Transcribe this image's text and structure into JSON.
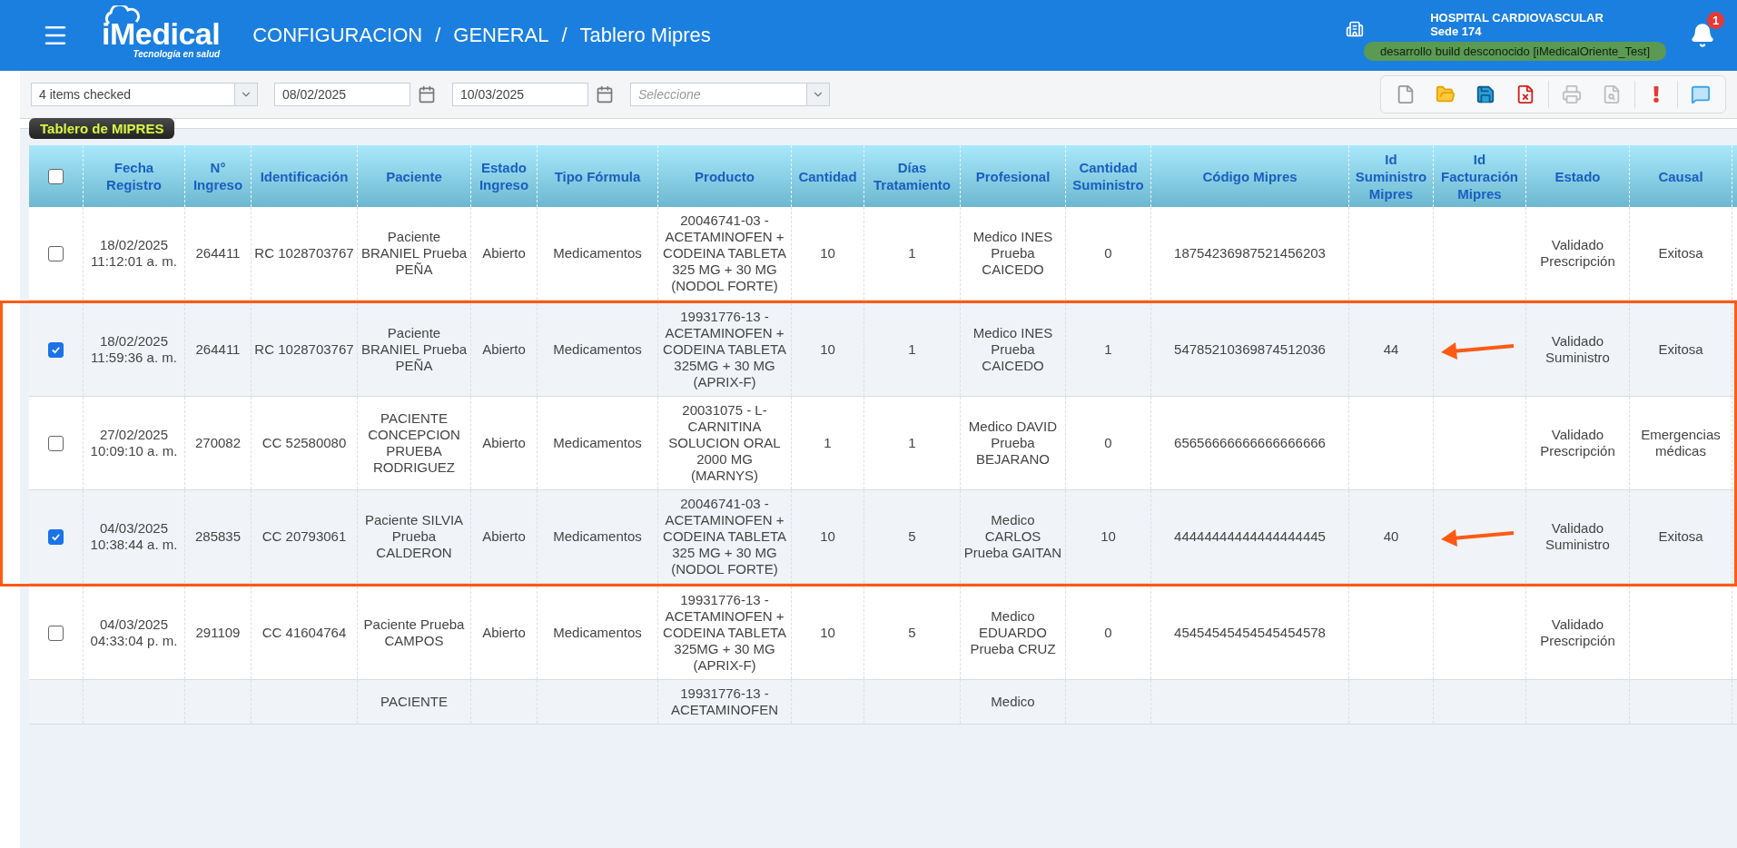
{
  "header": {
    "logo": {
      "name": "iMedical",
      "tagline": "Tecnología en salud"
    },
    "breadcrumb": {
      "separator": "/",
      "items": [
        "CONFIGURACION",
        "GENERAL",
        "Tablero Mipres"
      ]
    },
    "hospital": "HOSPITAL CARDIOVASCULAR",
    "sede": "Sede 174",
    "build": "desarrollo build desconocido [iMedicalOriente_Test]",
    "notifications": "1"
  },
  "filters": [
    {
      "kind": "multiselect",
      "value": "4 items checked"
    },
    {
      "kind": "date",
      "value": "08/02/2025"
    },
    {
      "kind": "date",
      "value": "10/03/2025"
    },
    {
      "kind": "select",
      "placeholder": "Seleccione"
    }
  ],
  "toolbar": [
    {
      "kind": "new",
      "disabled": false
    },
    {
      "kind": "open",
      "disabled": false
    },
    {
      "kind": "save",
      "disabled": false
    },
    {
      "kind": "delete",
      "disabled": false
    },
    {
      "kind": "print",
      "disabled": true
    },
    {
      "kind": "preview",
      "disabled": true
    },
    {
      "kind": "alert",
      "disabled": false
    },
    {
      "kind": "comment",
      "disabled": false
    }
  ],
  "section_title": "Tablero de MIPRES",
  "table": {
    "select_all": {
      "checked": false
    },
    "columns": [
      "Fecha Registro",
      "N° Ingreso",
      "Identificación",
      "Paciente",
      "Estado Ingreso",
      "Tipo Fórmula",
      "Producto",
      "Cantidad",
      "Días Tratamiento",
      "Profesional",
      "Cantidad Suministro",
      "Código Mipres",
      "Id Suministro Mipres",
      "Id Facturación Mipres",
      "Estado",
      "Causal"
    ],
    "rows": [
      {
        "checked": false,
        "annotated": false,
        "arrow": false,
        "cells": [
          "18/02/2025 11:12:01 a. m.",
          "264411",
          "RC 1028703767",
          "Paciente BRANIEL Prueba PEÑA",
          "Abierto",
          "Medicamentos",
          "20046741-03 - ACETAMINOFEN + CODEINA TABLETA 325 MG + 30 MG (NODOL FORTE)",
          "10",
          "1",
          "Medico INES Prueba CAICEDO",
          "0",
          "18754236987521456203",
          null,
          null,
          "Validado Prescripción",
          "Exitosa"
        ]
      },
      {
        "checked": true,
        "annotated": true,
        "arrow": true,
        "cells": [
          "18/02/2025 11:59:36 a. m.",
          "264411",
          "RC 1028703767",
          "Paciente BRANIEL Prueba PEÑA",
          "Abierto",
          "Medicamentos",
          "19931776-13 - ACETAMINOFEN + CODEINA TABLETA 325MG + 30 MG (APRIX-F)",
          "10",
          "1",
          "Medico INES Prueba CAICEDO",
          "1",
          "54785210369874512036",
          "44",
          null,
          "Validado Suministro",
          "Exitosa"
        ]
      },
      {
        "checked": false,
        "annotated": true,
        "arrow": false,
        "cells": [
          "27/02/2025 10:09:10 a. m.",
          "270082",
          "CC 52580080",
          "PACIENTE CONCEPCION PRUEBA RODRIGUEZ",
          "Abierto",
          "Medicamentos",
          "20031075 - L-CARNITINA SOLUCION ORAL 2000 MG (MARNYS)",
          "1",
          "1",
          "Medico DAVID Prueba BEJARANO",
          "0",
          "65656666666666666666",
          null,
          null,
          "Validado Prescripción",
          "Emergencias médicas"
        ]
      },
      {
        "checked": true,
        "annotated": true,
        "arrow": true,
        "cells": [
          "04/03/2025 10:38:44 a. m.",
          "285835",
          "CC 20793061",
          "Paciente SILVIA Prueba CALDERON",
          "Abierto",
          "Medicamentos",
          "20046741-03 - ACETAMINOFEN + CODEINA TABLETA 325 MG + 30 MG (NODOL FORTE)",
          "10",
          "5",
          "Medico CARLOS Prueba GAITAN",
          "10",
          "44444444444444444445",
          "40",
          null,
          "Validado Suministro",
          "Exitosa"
        ]
      },
      {
        "checked": false,
        "annotated": false,
        "arrow": false,
        "cells": [
          "04/03/2025 04:33:04 p. m.",
          "291109",
          "CC 41604764",
          "Paciente Prueba CAMPOS",
          "Abierto",
          "Medicamentos",
          "19931776-13 - ACETAMINOFEN + CODEINA TABLETA 325MG + 30 MG (APRIX-F)",
          "10",
          "5",
          "Medico EDUARDO Prueba CRUZ",
          "0",
          "45454545454545454578",
          null,
          null,
          "Validado Prescripción",
          null
        ]
      },
      {
        "annotated": false,
        "arrow": false,
        "cells": [
          null,
          null,
          null,
          "PACIENTE",
          null,
          null,
          "19931776-13 - ACETAMINOFEN",
          null,
          null,
          "Medico",
          null,
          null,
          null,
          null,
          null,
          null
        ]
      }
    ]
  }
}
